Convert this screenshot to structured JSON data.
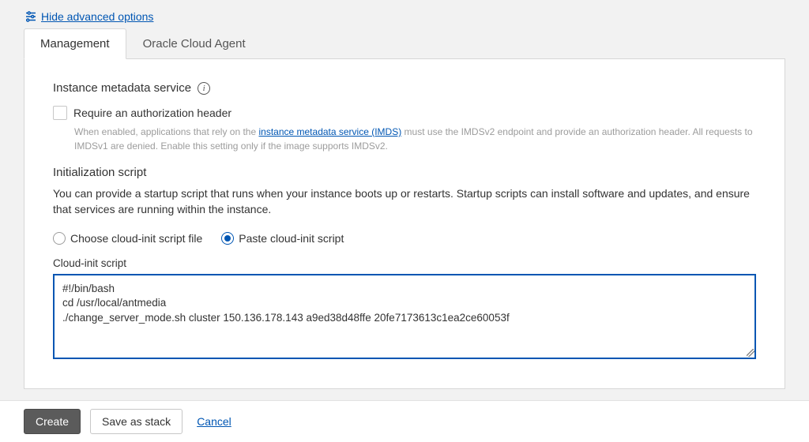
{
  "header": {
    "advanced_link": "Hide advanced options"
  },
  "tabs": {
    "management": "Management",
    "agent": "Oracle Cloud Agent"
  },
  "metadata": {
    "title": "Instance metadata service",
    "checkbox_label": "Require an authorization header",
    "help_pre": "When enabled, applications that rely on the ",
    "help_link": "instance metadata service (IMDS)",
    "help_post": " must use the IMDSv2 endpoint and provide an authorization header. All requests to IMDSv1 are denied. Enable this setting only if the image supports IMDSv2."
  },
  "init": {
    "title": "Initialization script",
    "description": "You can provide a startup script that runs when your instance boots up or restarts. Startup scripts can install software and updates, and ensure that services are running within the instance.",
    "radio_choose": "Choose cloud-init script file",
    "radio_paste": "Paste cloud-init script",
    "field_label": "Cloud-init script",
    "script_value": "#!/bin/bash\ncd /usr/local/antmedia\n./change_server_mode.sh cluster 150.136.178.143 a9ed38d48ffe 20fe7173613c1ea2ce60053f"
  },
  "footer": {
    "create": "Create",
    "save_stack": "Save as stack",
    "cancel": "Cancel"
  }
}
